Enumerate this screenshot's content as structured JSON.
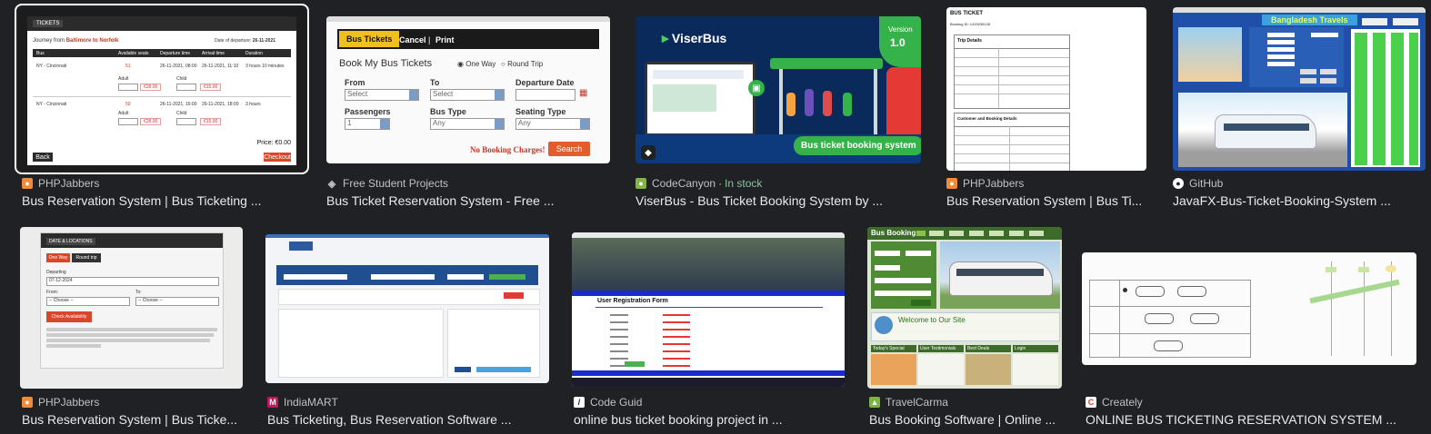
{
  "results": [
    {
      "source": "PHPJabbers",
      "title": "Bus Reservation System | Bus Ticketing ...",
      "favicon_color": "#f28b38"
    },
    {
      "source": "Free Student Projects",
      "title": "Bus Ticket Reservation System - Free ...",
      "favicon_color": "#5f6368"
    },
    {
      "source": "CodeCanyon",
      "stock": "In stock",
      "title": "ViserBus - Bus Ticket Booking System by ...",
      "favicon_color": "#82b541"
    },
    {
      "source": "PHPJabbers",
      "title": "Bus Reservation System | Bus Ti...",
      "favicon_color": "#f28b38"
    },
    {
      "source": "GitHub",
      "title": "JavaFX-Bus-Ticket-Booking-System ...",
      "favicon_color": "#ffffff"
    },
    {
      "source": "PHPJabbers",
      "title": "Bus Reservation System | Bus Ticke...",
      "favicon_color": "#f28b38"
    },
    {
      "source": "IndiaMART",
      "title": "Bus Ticketing, Bus Reservation Software ...",
      "favicon_color": "#c2185b"
    },
    {
      "source": "Code Guid",
      "title": "online bus ticket booking project in ...",
      "favicon_color": "#ffffff"
    },
    {
      "source": "TravelCarma",
      "title": "Bus Booking Software | Online ...",
      "favicon_color": "#7cb342"
    },
    {
      "source": "Creately",
      "title": "ONLINE BUS TICKETING RESERVATION SYSTEM ...",
      "favicon_color": "#e53935"
    }
  ],
  "thumb1": {
    "tab": "TICKETS",
    "journey_prefix": "Journey from",
    "journey_route": "Baltimore to Norfolk",
    "date_label": "Date of departure:",
    "date_value": "26-11-2021",
    "headers": [
      "Bus",
      "Available seats",
      "Departure time",
      "Arrival time",
      "Duration"
    ],
    "rows": [
      {
        "bus": "NY - Cincinnati",
        "seats": "51",
        "dep": "26-11-2021, 08:00",
        "arr": "26-11-2021, 11:10",
        "dur": "3 hours 10 minutes",
        "adult_price": "€28.00",
        "child_price": "€15.00"
      },
      {
        "bus": "NY - Cincinnati",
        "seats": "50",
        "dep": "26-11-2021, 15:00",
        "arr": "26-11-2021, 18:00",
        "dur": "3 hours",
        "adult_price": "€28.00",
        "child_price": "€15.00"
      }
    ],
    "adult_label": "Adult",
    "child_label": "Child",
    "price": "Price: €0.00",
    "back": "Back",
    "checkout": "Checkout"
  },
  "thumb2": {
    "tab_active": "Bus Tickets",
    "tab_cancel": "Cancel",
    "tab_print": "Print",
    "heading": "Book My Bus Tickets",
    "one_way": "One Way",
    "round_trip": "Round Trip",
    "from": "From",
    "to": "To",
    "departure_date": "Departure Date",
    "passengers": "Passengers",
    "bus_type": "Bus Type",
    "seating_type": "Seating Type",
    "select": "Select",
    "any": "Any",
    "one": "1",
    "no_booking": "No Booking Charges!",
    "search": "Search"
  },
  "thumb3": {
    "brand": "ViserBus",
    "version_label": "Version",
    "version_num": "1.0",
    "banner": "Bus ticket booking system"
  },
  "thumb4": {
    "title": "BUS TICKET",
    "booking_id": "Booking ID: 1415235128",
    "trip_details": "Trip Details",
    "customer_details": "Customer and Booking Details"
  },
  "thumb5": {
    "app_title": "Bangladesh Travels"
  },
  "thumb6": {
    "tab": "DATE & LOCATIONS",
    "one_way": "One Way",
    "round_trip": "Round trip",
    "departing": "Departing",
    "date": "07-12-2024",
    "from": "From:",
    "to": "To:",
    "choose": "-- Choose --",
    "check": "Check Availability"
  },
  "thumb8": {
    "form_title": "User Registration Form"
  },
  "thumb9": {
    "logo": "Bus Booking",
    "welcome": "Welcome to Our Site",
    "sections": [
      "Today's Special",
      "User Testimonials",
      "Best Deals",
      "Login"
    ]
  }
}
